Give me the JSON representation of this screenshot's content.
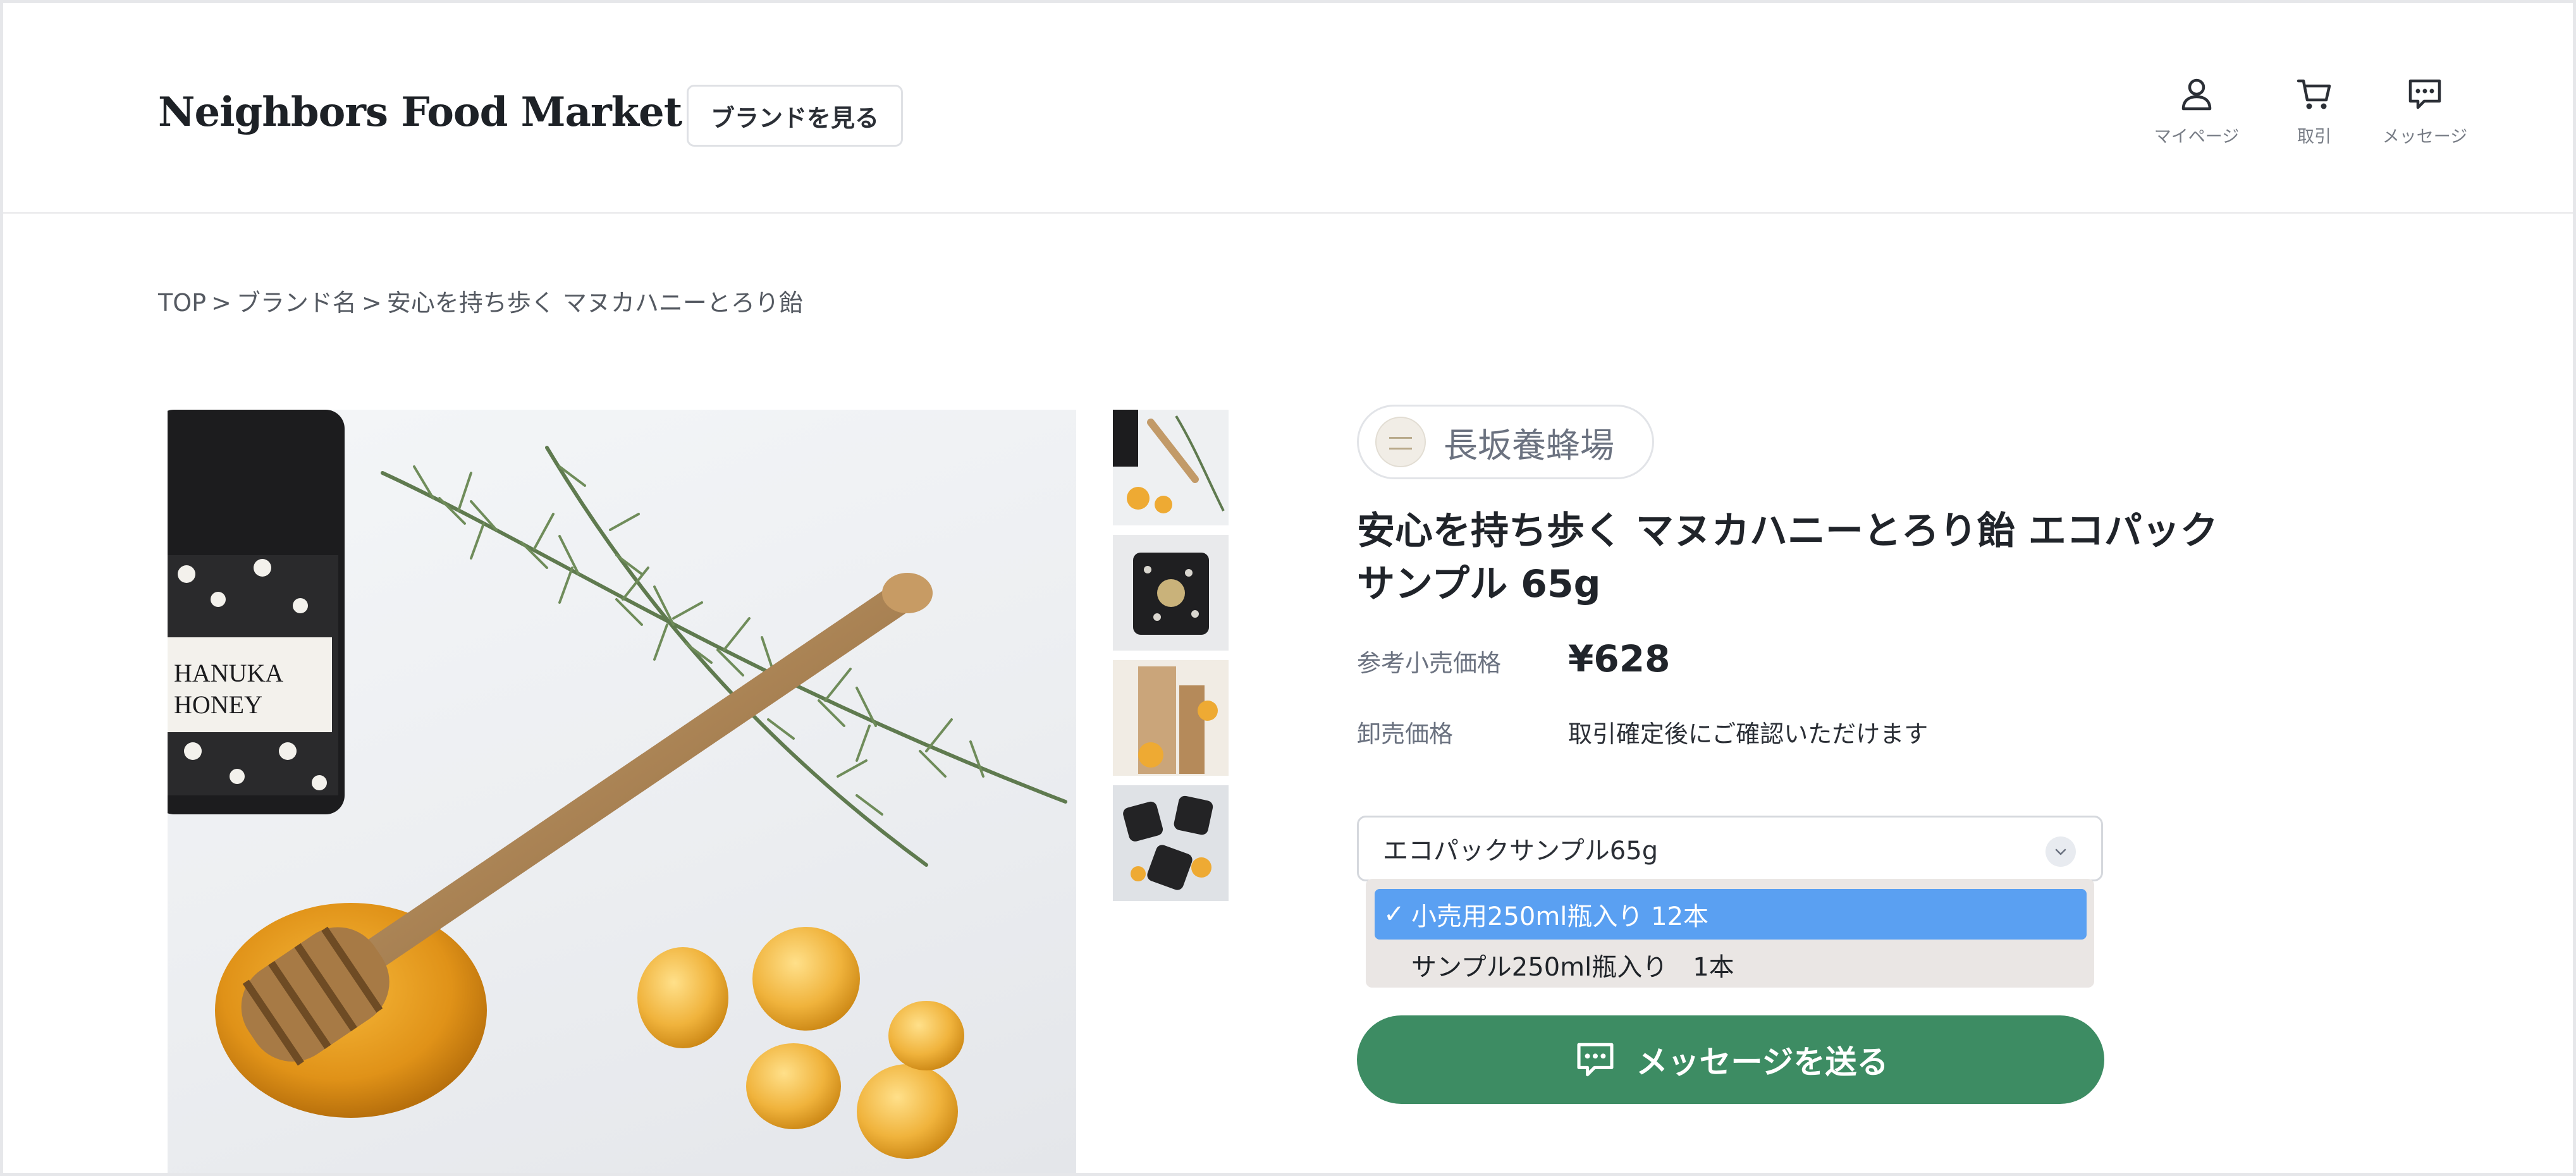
{
  "header": {
    "logo_text": "Neighbors Food Market",
    "brand_button_label": "ブランドを見る",
    "nav": {
      "mypage_label": "マイページ",
      "deal_label": "取引",
      "message_label": "メッセージ"
    }
  },
  "breadcrumb": {
    "items": [
      "TOP",
      "ブランド名",
      "安心を持ち歩く マヌカハニーとろり飴"
    ],
    "separator": ">"
  },
  "gallery": {
    "main_jar_label": "HANUKA HONEY",
    "thumbnail_count": 4
  },
  "product": {
    "brand_name": "長坂養蜂場",
    "title_line1": "安心を持ち歩く マヌカハニーとろり飴 エコパック",
    "title_line2": "サンプル 65g",
    "retail_price_label": "参考小売価格",
    "retail_price": "¥628",
    "wholesale_price_label": "卸売価格",
    "wholesale_price_note": "取引確定後にご確認いただけます"
  },
  "variant_select": {
    "current_value": "エコパックサンプル65g",
    "options_visible": [
      {
        "label": "小売用250ml瓶入り 12本",
        "selected": true
      },
      {
        "label": "サンプル250ml瓶入り　1本",
        "selected": false
      }
    ],
    "check_mark": "✓"
  },
  "actions": {
    "send_message_label": "メッセージを送る"
  },
  "colors": {
    "accent_green": "#3d8c63",
    "selection_blue": "#5aa0f2"
  }
}
